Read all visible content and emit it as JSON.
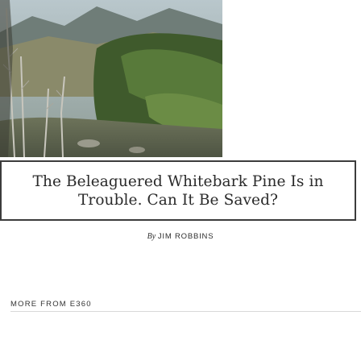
{
  "article": {
    "headline": "The Beleaguered Whitebark Pine Is in Trouble. Can It Be Saved?",
    "byline_prefix": "By",
    "author": "JIM ROBBINS"
  },
  "more_section": {
    "label": "MORE FROM E360"
  },
  "colors": {
    "border": "#3c3c3c",
    "text": "#2a2a2a",
    "divider": "#d9d9d9"
  }
}
